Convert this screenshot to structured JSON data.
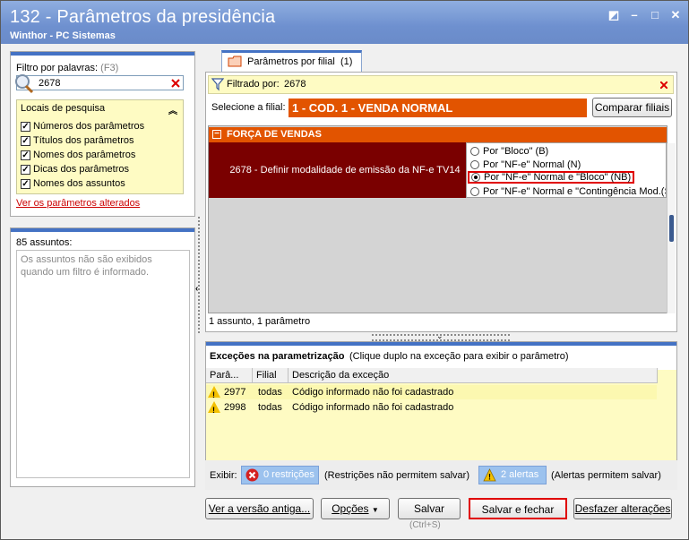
{
  "window": {
    "title": "132 - Parâmetros da presidência",
    "subtitle": "Winthor - PC Sistemas",
    "controls": [
      "◩",
      "–",
      "□",
      "✕"
    ]
  },
  "left": {
    "filter_label": "Filtro por palavras:",
    "filter_shortcut": "(F3)",
    "search_value": "2678",
    "locais_title": "Locais de pesquisa",
    "locais_items": [
      {
        "label": "Números dos parâmetros",
        "checked": true
      },
      {
        "label": "Títulos dos parâmetros",
        "checked": true
      },
      {
        "label": "Nomes dos parâmetros",
        "checked": true
      },
      {
        "label": "Dicas dos parâmetros",
        "checked": true
      },
      {
        "label": "Nomes dos assuntos",
        "checked": true
      }
    ],
    "altered_link": "Ver os parâmetros alterados",
    "subjects_count": "85 assuntos:",
    "subjects_note": "Os assuntos não são exibidos quando um filtro é informado."
  },
  "tab": {
    "label": "Parâmetros por filial",
    "count": "(1)"
  },
  "filter_bar": {
    "label": "Filtrado por:",
    "value": "2678"
  },
  "filial": {
    "label": "Selecione a filial:",
    "value": "1 - COD. 1 - VENDA NORMAL",
    "compare_button": "Comparar filiais"
  },
  "grid": {
    "group_toggle": "−",
    "group": "FORÇA DE VENDAS",
    "param_desc": "2678 - Definir modalidade de emissão da NF-e TV14",
    "options": [
      {
        "label": "Por \"Bloco\" (B)",
        "selected": false
      },
      {
        "label": "Por \"NF-e\" Normal (N)",
        "selected": false
      },
      {
        "label": "Por \"NF-e\" Normal e \"Bloco\" (NB)",
        "selected": true
      },
      {
        "label": "Por \"NF-e\" Normal e \"Contingência Mod.(S",
        "selected": false
      }
    ],
    "status": "1 assunto, 1 parâmetro"
  },
  "exceptions": {
    "title": "Exceções na parametrização",
    "hint": "(Clique duplo na exceção para exibir o parâmetro)",
    "columns": [
      "Parâ...",
      "Filial",
      "Descrição da exceção"
    ],
    "rows": [
      {
        "param": "2977",
        "filial": "todas",
        "desc": "Código informado não foi cadastrado"
      },
      {
        "param": "2998",
        "filial": "todas",
        "desc": "Código informado não foi cadastrado"
      }
    ],
    "show_label": "Exibir:",
    "restrictions_pill": "0 restrições",
    "restrictions_note": "(Restrições não permitem salvar)",
    "alerts_pill": "2 alertas",
    "alerts_note": "(Alertas permitem salvar)"
  },
  "footer": {
    "old_version": "Ver a versão antiga...",
    "options": "Opções",
    "save": "Salvar",
    "save_shortcut": "(Ctrl+S)",
    "save_close": "Salvar e fechar",
    "undo": "Desfazer alterações"
  },
  "colors": {
    "accent": "#4472c4",
    "filial_orange": "#e25400",
    "param_dark": "#7a0000",
    "highlight_red": "#e00000",
    "yellow_bg": "#fefbc3"
  }
}
